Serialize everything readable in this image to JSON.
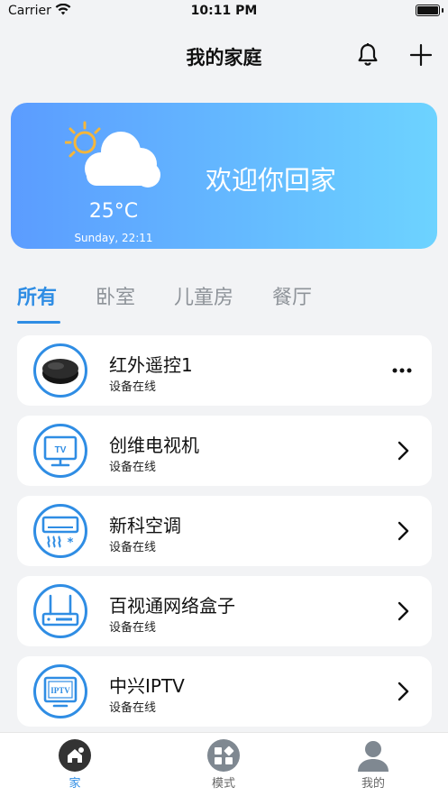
{
  "status_bar": {
    "carrier": "Carrier",
    "time": "10:11 PM"
  },
  "header": {
    "title": "我的家庭"
  },
  "weather": {
    "temperature": "25°C",
    "date": "Sunday, 22:11",
    "welcome": "欢迎你回家"
  },
  "tabs": [
    {
      "label": "所有",
      "active": true
    },
    {
      "label": "卧室",
      "active": false
    },
    {
      "label": "儿童房",
      "active": false
    },
    {
      "label": "餐厅",
      "active": false
    }
  ],
  "devices": [
    {
      "name": "红外遥控1",
      "status": "设备在线",
      "icon": "ir-remote-icon",
      "action": "more-icon"
    },
    {
      "name": "创维电视机",
      "status": "设备在线",
      "icon": "tv-icon",
      "action": "chevron-right-icon"
    },
    {
      "name": "新科空调",
      "status": "设备在线",
      "icon": "air-conditioner-icon",
      "action": "chevron-right-icon"
    },
    {
      "name": "百视通网络盒子",
      "status": "设备在线",
      "icon": "network-box-icon",
      "action": "chevron-right-icon"
    },
    {
      "name": "中兴IPTV",
      "status": "设备在线",
      "icon": "iptv-icon",
      "action": "chevron-right-icon"
    }
  ],
  "tabbar": [
    {
      "label": "家",
      "icon": "home-icon",
      "active": true
    },
    {
      "label": "模式",
      "icon": "mode-icon",
      "active": false
    },
    {
      "label": "我的",
      "icon": "profile-icon",
      "active": false
    }
  ],
  "colors": {
    "accent": "#2f8de4",
    "banner_start": "#5b9cff",
    "banner_end": "#6dd3ff"
  }
}
